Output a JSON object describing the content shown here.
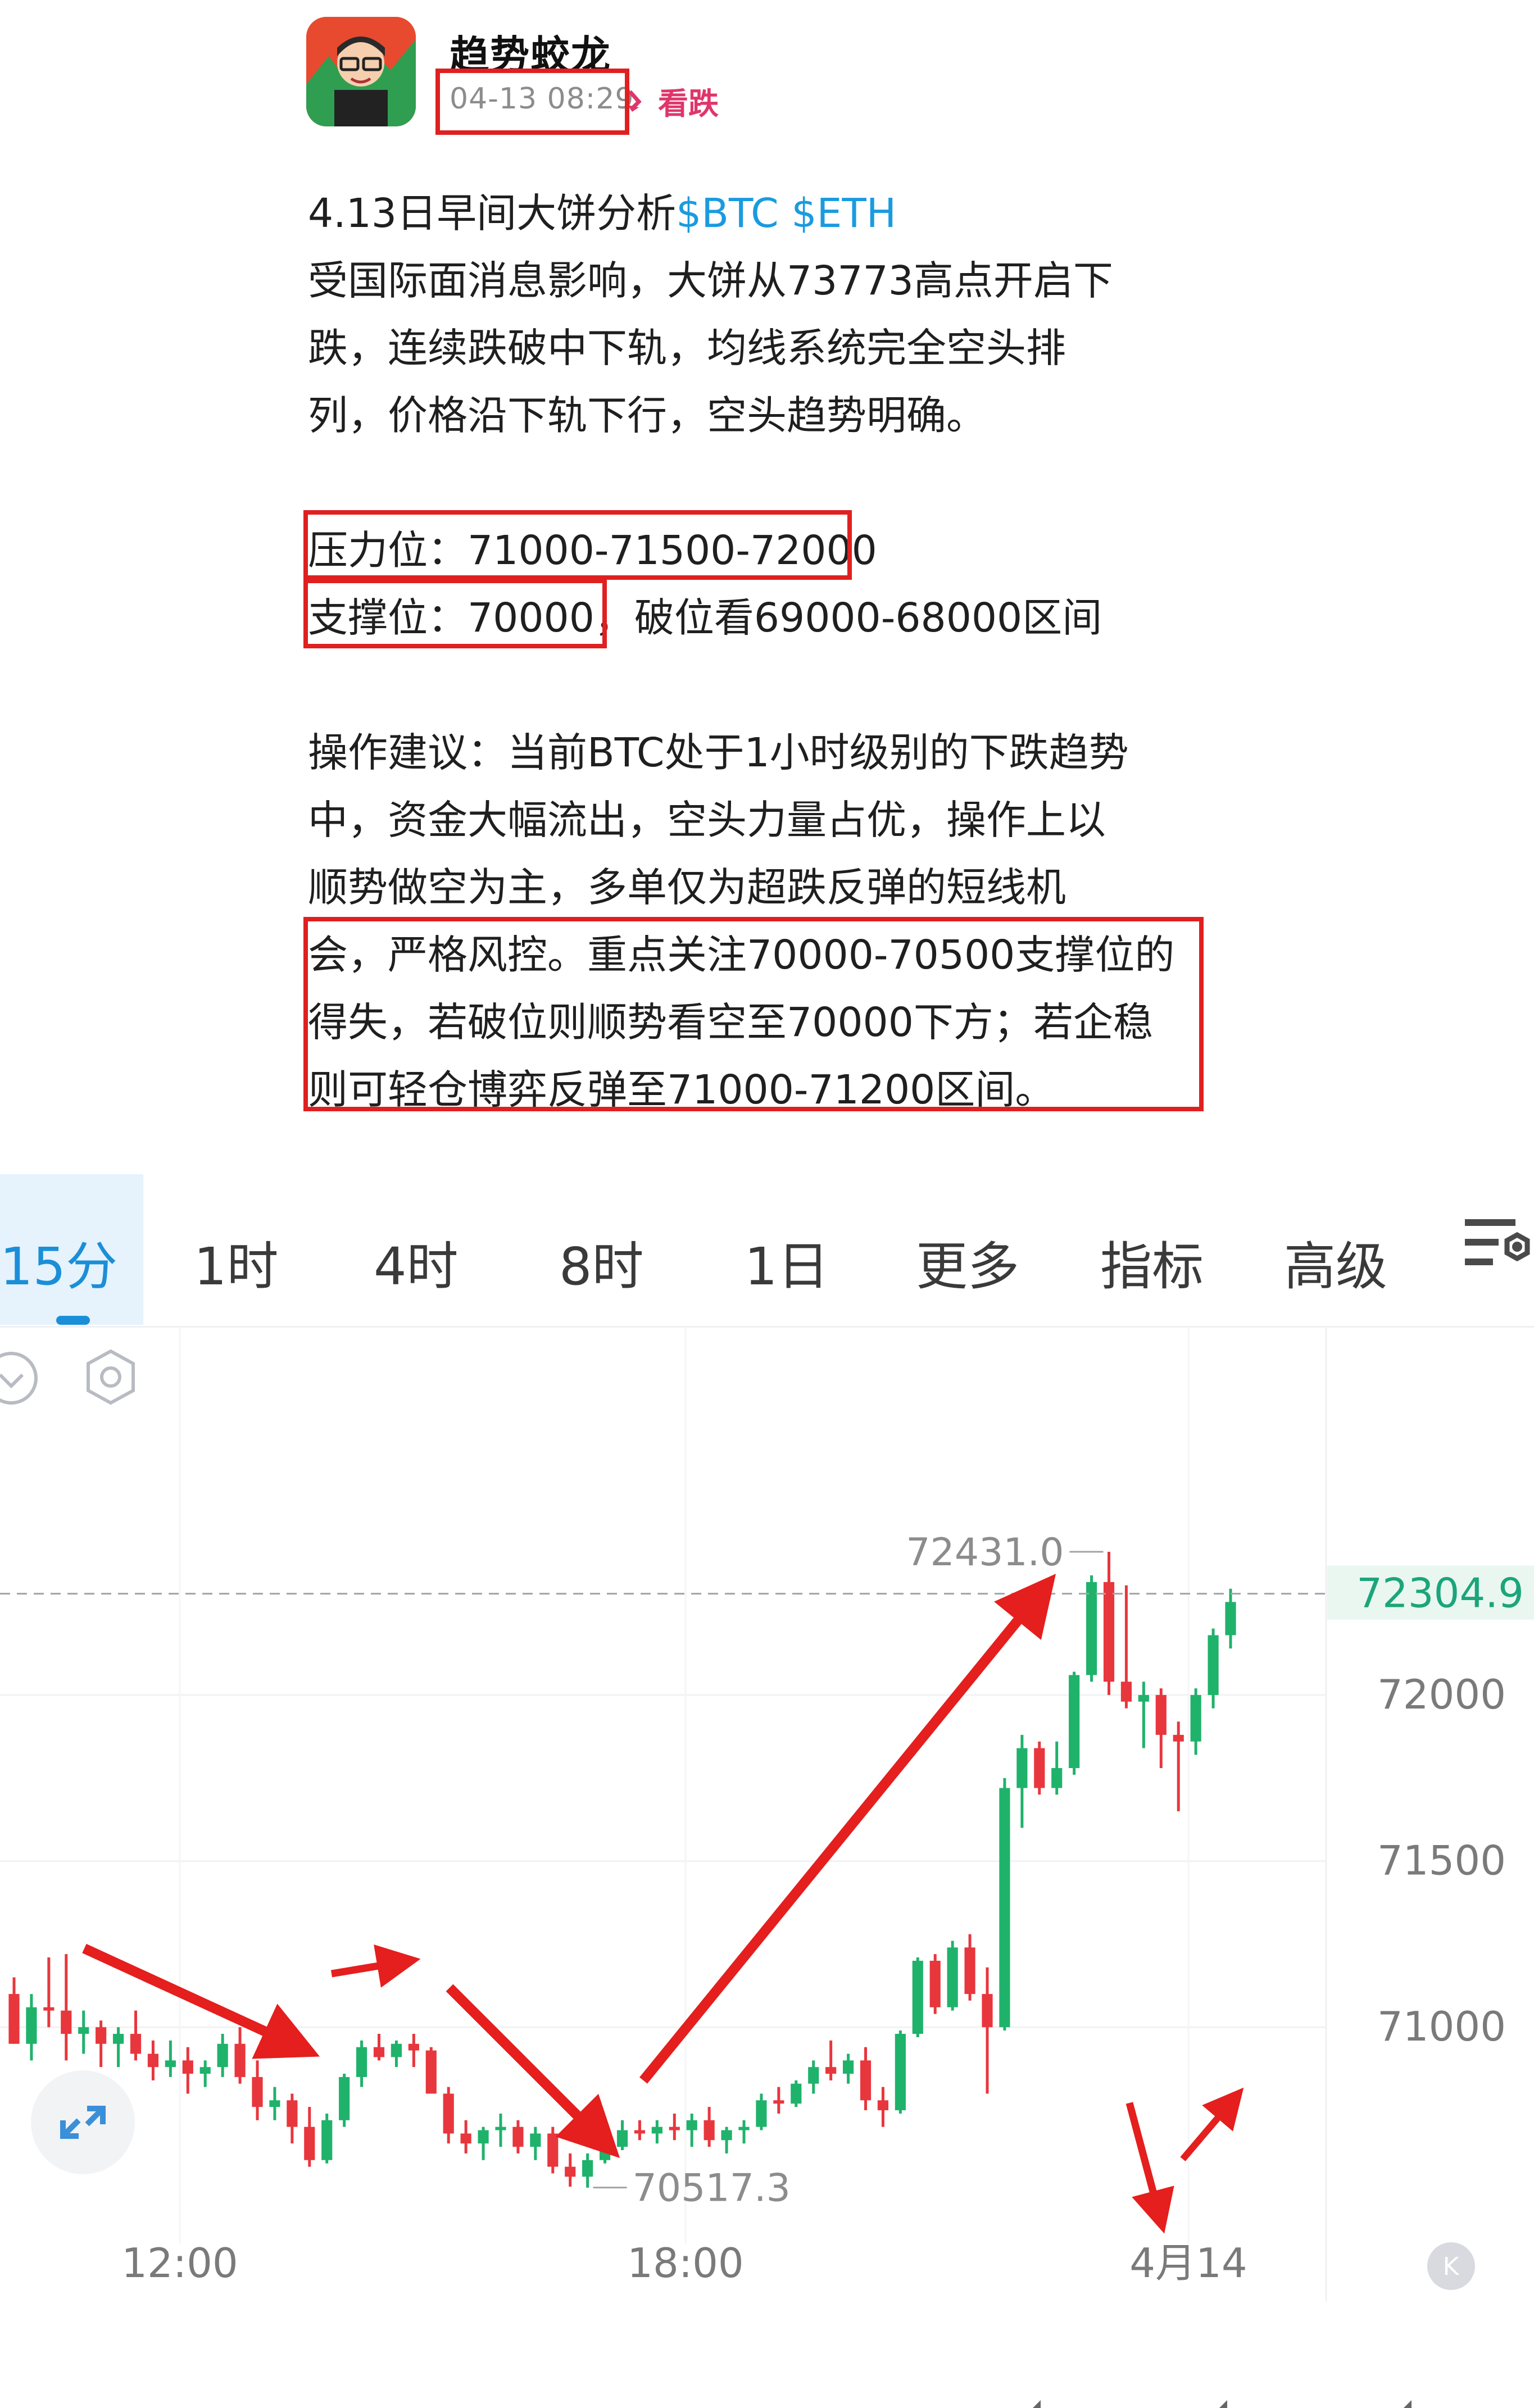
{
  "post": {
    "author": "趋势蛟龙",
    "time": "04-13 08:29",
    "stance": "看跌",
    "lines": [
      {
        "text": "4.13日早间大饼分析",
        "tags": "$BTC $ETH"
      },
      {
        "text": "受国际面消息影响，大饼从73773高点开启下"
      },
      {
        "text": "跌，连续跌破中下轨，均线系统完全空头排"
      },
      {
        "text": "列，价格沿下轨下行，空头趋势明确。"
      },
      {
        "text": ""
      },
      {
        "text": "压力位：71000-71500-72000"
      },
      {
        "text": "支撑位：70000，破位看69000-68000区间"
      },
      {
        "text": ""
      },
      {
        "text": "操作建议：当前BTC处于1小时级别的下跌趋势"
      },
      {
        "text": "中，资金大幅流出，空头力量占优，操作上以"
      },
      {
        "text": "顺势做空为主，多单仅为超跌反弹的短线机"
      },
      {
        "text": "会，严格风控。重点关注70000-70500支撑位的"
      },
      {
        "text": "得失，若破位则顺势看空至70000下方；若企稳"
      },
      {
        "text": "则可轻仓博弈反弹至71000-71200区间。"
      }
    ]
  },
  "tabs": {
    "items": [
      "15分",
      "1时",
      "4时",
      "8时",
      "1日",
      "更多",
      "指标",
      "高级"
    ],
    "active": "15分",
    "caret_items": [
      "更多",
      "指标",
      "高级"
    ]
  },
  "chart_data": {
    "type": "candlestick",
    "interval": "15分",
    "y_ticks": [
      72000,
      71500,
      71000
    ],
    "x_ticks": [
      "12:00",
      "18:00",
      "4月14"
    ],
    "current_price": "72304.9",
    "high_label": "72431.0",
    "low_label": "70517.3",
    "ylim": [
      70400,
      72700
    ],
    "up_color": "#1fb26b",
    "down_color": "#e8363d",
    "candles": [
      [
        71100,
        71150,
        70950,
        70950
      ],
      [
        70950,
        71100,
        70900,
        71060
      ],
      [
        71060,
        71210,
        71000,
        71050
      ],
      [
        71050,
        71220,
        70900,
        70980
      ],
      [
        70980,
        71050,
        70920,
        71000
      ],
      [
        71000,
        71020,
        70880,
        70950
      ],
      [
        70950,
        71000,
        70880,
        70980
      ],
      [
        70980,
        71050,
        70900,
        70920
      ],
      [
        70920,
        70960,
        70840,
        70880
      ],
      [
        70880,
        70960,
        70850,
        70900
      ],
      [
        70900,
        70940,
        70800,
        70860
      ],
      [
        70860,
        70900,
        70820,
        70880
      ],
      [
        70880,
        70980,
        70850,
        70950
      ],
      [
        70950,
        71000,
        70830,
        70850
      ],
      [
        70850,
        70900,
        70720,
        70760
      ],
      [
        70760,
        70820,
        70720,
        70780
      ],
      [
        70780,
        70800,
        70650,
        70700
      ],
      [
        70700,
        70760,
        70580,
        70600
      ],
      [
        70600,
        70740,
        70590,
        70720
      ],
      [
        70720,
        70860,
        70700,
        70850
      ],
      [
        70850,
        70960,
        70820,
        70940
      ],
      [
        70940,
        70980,
        70900,
        70910
      ],
      [
        70910,
        70960,
        70880,
        70950
      ],
      [
        70950,
        70980,
        70880,
        70930
      ],
      [
        70930,
        70940,
        70800,
        70800
      ],
      [
        70800,
        70820,
        70650,
        70680
      ],
      [
        70680,
        70720,
        70620,
        70650
      ],
      [
        70650,
        70700,
        70600,
        70690
      ],
      [
        70690,
        70740,
        70640,
        70700
      ],
      [
        70700,
        70720,
        70620,
        70640
      ],
      [
        70640,
        70700,
        70600,
        70680
      ],
      [
        70680,
        70700,
        70560,
        70580
      ],
      [
        70580,
        70620,
        70520,
        70550
      ],
      [
        70550,
        70620,
        70517,
        70600
      ],
      [
        70600,
        70660,
        70590,
        70640
      ],
      [
        70640,
        70720,
        70630,
        70690
      ],
      [
        70690,
        70720,
        70660,
        70680
      ],
      [
        70680,
        70720,
        70650,
        70700
      ],
      [
        70700,
        70740,
        70660,
        70690
      ],
      [
        70690,
        70740,
        70640,
        70720
      ],
      [
        70720,
        70760,
        70640,
        70660
      ],
      [
        70660,
        70700,
        70620,
        70690
      ],
      [
        70690,
        70720,
        70650,
        70700
      ],
      [
        70700,
        70800,
        70690,
        70780
      ],
      [
        70780,
        70820,
        70740,
        70770
      ],
      [
        70770,
        70840,
        70760,
        70830
      ],
      [
        70830,
        70900,
        70800,
        70880
      ],
      [
        70880,
        70960,
        70840,
        70860
      ],
      [
        70860,
        70920,
        70830,
        70900
      ],
      [
        70900,
        70940,
        70750,
        70780
      ],
      [
        70780,
        70820,
        70700,
        70750
      ],
      [
        70750,
        70990,
        70740,
        70980
      ],
      [
        70980,
        71210,
        70970,
        71200
      ],
      [
        71200,
        71220,
        71040,
        71060
      ],
      [
        71060,
        71260,
        71050,
        71240
      ],
      [
        71240,
        71280,
        71080,
        71100
      ],
      [
        71100,
        71180,
        70800,
        71000
      ],
      [
        71000,
        71750,
        70990,
        71720
      ],
      [
        71720,
        71880,
        71600,
        71840
      ],
      [
        71840,
        71860,
        71700,
        71720
      ],
      [
        71720,
        71860,
        71700,
        71780
      ],
      [
        71780,
        72070,
        71760,
        72060
      ],
      [
        72060,
        72360,
        72040,
        72340
      ],
      [
        72340,
        72431,
        72000,
        72040
      ],
      [
        72040,
        72330,
        71960,
        71980
      ],
      [
        71980,
        72040,
        71840,
        72000
      ],
      [
        72000,
        72020,
        71780,
        71880
      ],
      [
        71880,
        71920,
        71650,
        71860
      ],
      [
        71860,
        72020,
        71820,
        72000
      ],
      [
        72000,
        72200,
        71960,
        72180
      ],
      [
        72180,
        72320,
        72140,
        72280
      ]
    ]
  }
}
